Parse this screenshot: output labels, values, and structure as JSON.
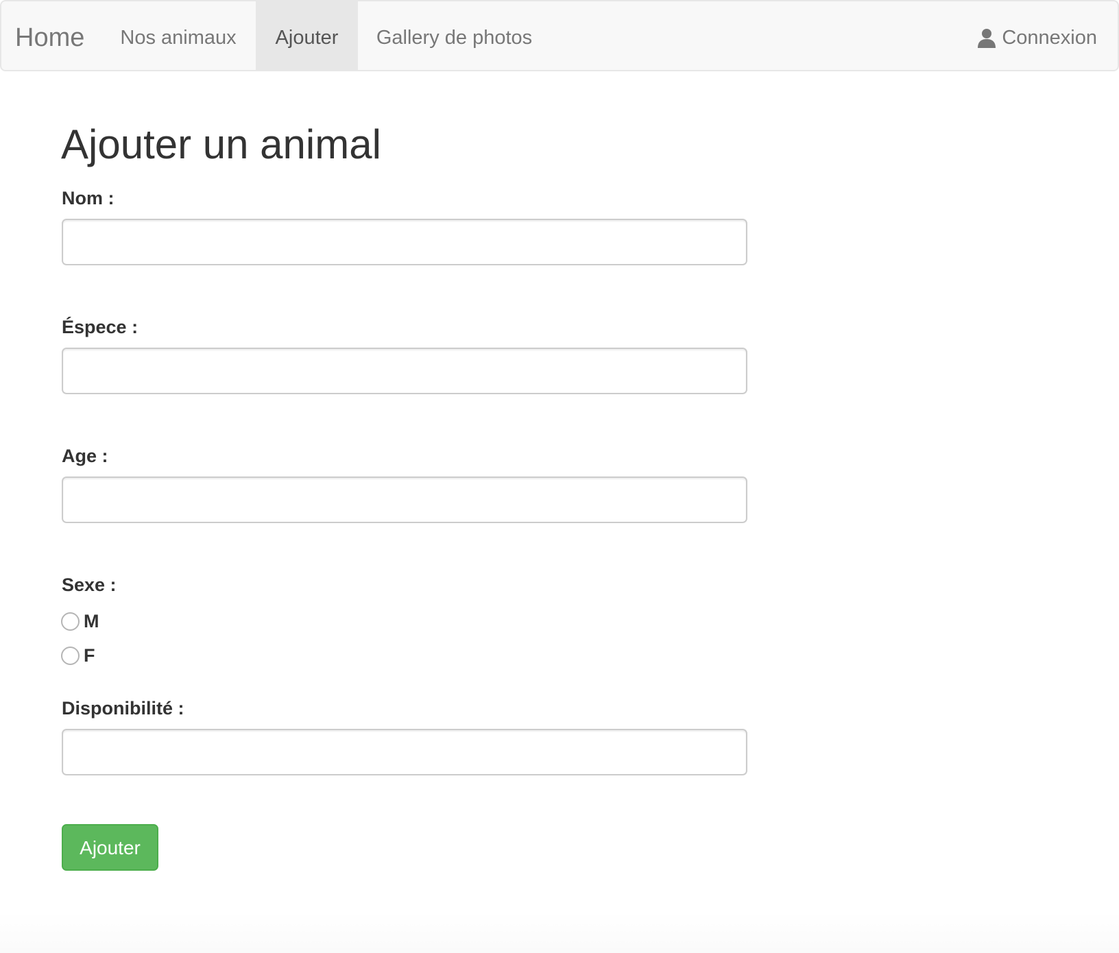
{
  "navbar": {
    "brand": "Home",
    "items": [
      {
        "label": "Nos animaux",
        "active": false
      },
      {
        "label": "Ajouter",
        "active": true
      },
      {
        "label": "Gallery de photos",
        "active": false
      }
    ],
    "login": {
      "label": "Connexion",
      "icon": "user-icon"
    }
  },
  "form": {
    "title": "Ajouter un animal",
    "fields": {
      "nom": {
        "label": "Nom :",
        "value": ""
      },
      "espece": {
        "label": "Éspece :",
        "value": ""
      },
      "age": {
        "label": "Age :",
        "value": ""
      },
      "disponibilite": {
        "label": "Disponibilité :",
        "value": ""
      }
    },
    "sexe": {
      "label": "Sexe :",
      "options": [
        {
          "label": "M",
          "checked": false
        },
        {
          "label": "F",
          "checked": false
        }
      ]
    },
    "submit_label": "Ajouter"
  },
  "colors": {
    "navbar_bg": "#f8f8f8",
    "nav_active_bg": "#e7e7e7",
    "nav_text": "#777777",
    "button_success": "#5cb85c",
    "text": "#333333"
  }
}
